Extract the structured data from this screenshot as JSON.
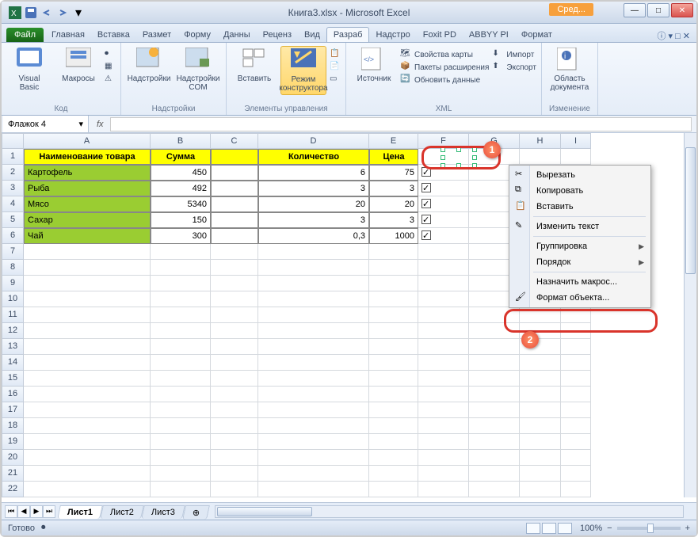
{
  "title": "Книга3.xlsx - Microsoft Excel",
  "sred": "Сред...",
  "tabs": {
    "file": "Файл",
    "items": [
      "Главная",
      "Вставка",
      "Размет",
      "Форму",
      "Данны",
      "Реценз",
      "Вид",
      "Разраб",
      "Надстро",
      "Foxit PD",
      "ABBYY PI",
      "Формат"
    ],
    "activeIndex": 7
  },
  "ribbon": {
    "groups": [
      {
        "label": "Код",
        "big": [
          {
            "name": "visual-basic",
            "label": "Visual Basic"
          },
          {
            "name": "macros",
            "label": "Макросы"
          }
        ]
      },
      {
        "label": "Надстройки",
        "big": [
          {
            "name": "addins",
            "label": "Надстройки"
          },
          {
            "name": "com-addins",
            "label": "Надстройки COM"
          }
        ]
      },
      {
        "label": "Элементы управления",
        "big": [
          {
            "name": "insert",
            "label": "Вставить"
          },
          {
            "name": "design-mode",
            "label": "Режим конструктора",
            "active": true
          }
        ]
      },
      {
        "label": "XML",
        "big": [
          {
            "name": "source",
            "label": "Источник"
          }
        ],
        "small": [
          {
            "label": "Свойства карты"
          },
          {
            "label": "Пакеты расширения"
          },
          {
            "label": "Обновить данные"
          }
        ],
        "small2": [
          {
            "label": "Импорт"
          },
          {
            "label": "Экспорт"
          }
        ]
      },
      {
        "label": "Изменение",
        "big": [
          {
            "name": "doc-panel",
            "label": "Область документа"
          }
        ]
      }
    ]
  },
  "namebox": "Флажок 4",
  "columns": [
    "A",
    "B",
    "C",
    "D",
    "E",
    "F",
    "G",
    "H",
    "I"
  ],
  "header_row": {
    "A": "Наименование товара",
    "B": "Сумма",
    "D": "Количество",
    "E": "Цена"
  },
  "rows": [
    {
      "A": "Картофель",
      "B": "450",
      "D": "6",
      "E": "75",
      "chk": true
    },
    {
      "A": "Рыба",
      "B": "492",
      "D": "3",
      "E": "3",
      "chk": true
    },
    {
      "A": "Мясо",
      "B": "5340",
      "D": "20",
      "E": "20",
      "chk": true
    },
    {
      "A": "Сахар",
      "B": "150",
      "D": "3",
      "E": "3",
      "chk": true
    },
    {
      "A": "Чай",
      "B": "300",
      "D": "0,3",
      "E": "1000",
      "chk": true
    }
  ],
  "context_menu": [
    {
      "label": "Вырезать",
      "icon": "cut"
    },
    {
      "label": "Копировать",
      "icon": "copy"
    },
    {
      "label": "Вставить",
      "icon": "paste"
    },
    {
      "sep": true
    },
    {
      "label": "Изменить текст",
      "icon": "edit"
    },
    {
      "sep": true
    },
    {
      "label": "Группировка",
      "submenu": true
    },
    {
      "label": "Порядок",
      "submenu": true
    },
    {
      "sep": true
    },
    {
      "label": "Назначить макрос..."
    },
    {
      "label": "Формат объекта...",
      "icon": "format",
      "highlight": true
    }
  ],
  "sheets": [
    "Лист1",
    "Лист2",
    "Лист3"
  ],
  "active_sheet": 0,
  "status": "Готово",
  "zoom": "100%"
}
